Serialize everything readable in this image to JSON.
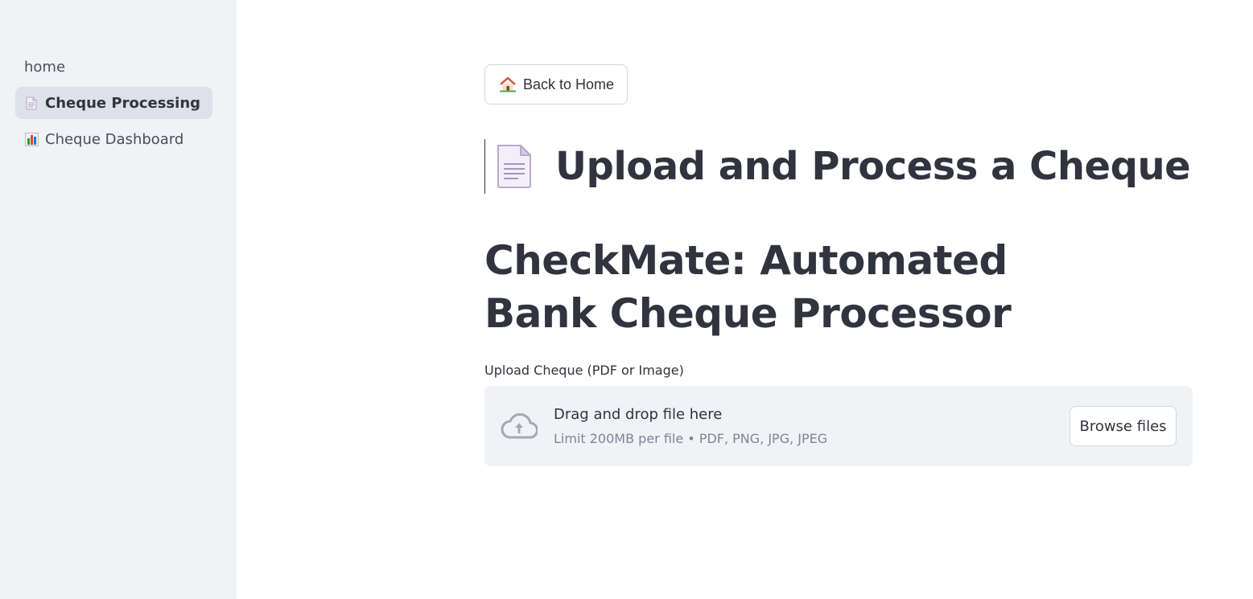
{
  "sidebar": {
    "items": [
      {
        "label": "home",
        "icon": "",
        "active": false
      },
      {
        "label": "Cheque Processing",
        "icon": "document-icon",
        "active": true
      },
      {
        "label": "Cheque Dashboard",
        "icon": "bar-chart-icon",
        "active": false
      }
    ]
  },
  "main": {
    "back_button": {
      "label": "Back to Home",
      "icon": "house-icon"
    },
    "title": "Upload and Process a Cheque",
    "title_icon": "document-icon",
    "subtitle": "CheckMate: Automated Bank Cheque Processor",
    "uploader": {
      "label": "Upload Cheque (PDF or Image)",
      "drop_text": "Drag and drop file here",
      "limit_text": "Limit 200MB per file • PDF, PNG, JPG, JPEG",
      "browse_label": "Browse files",
      "icon": "cloud-upload-icon"
    }
  },
  "colors": {
    "sidebar_bg": "#f0f2f6",
    "active_item_bg": "#dde1ea",
    "text": "#31333f",
    "muted_text": "#808495",
    "border": "#d6d7db"
  }
}
